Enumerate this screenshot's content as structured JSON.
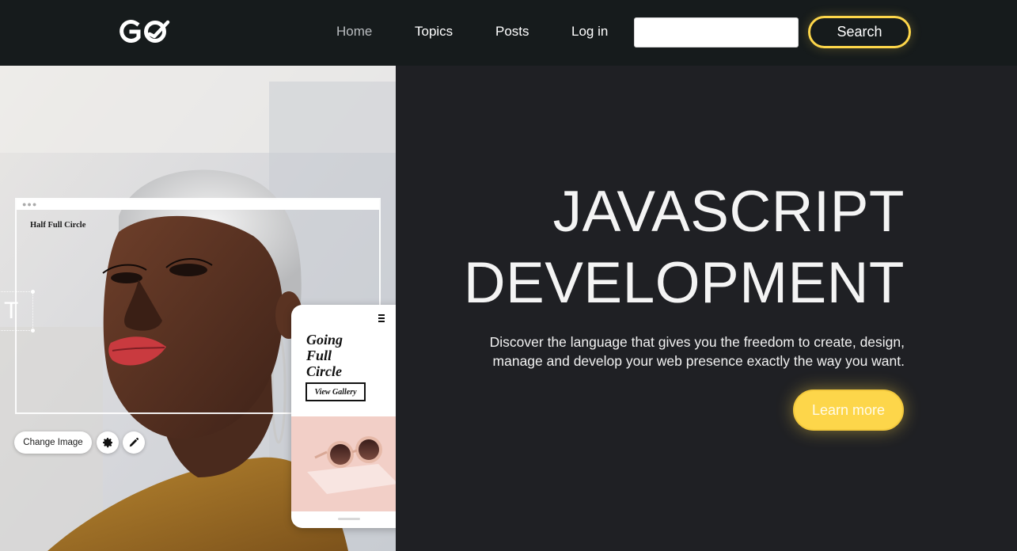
{
  "header": {
    "logo_alt": "GO logo",
    "nav": {
      "home": "Home",
      "topics": "Topics",
      "posts": "Posts",
      "login": "Log in"
    },
    "search_placeholder": "",
    "search_button": "Search"
  },
  "hero": {
    "title_line1": "JAVASCRIPT",
    "title_line2": "DEVELOPMENT",
    "subtitle_line1": "Discover the language that gives you the freedom to create, design,",
    "subtitle_line2": "manage and develop your web presence exactly the way you want.",
    "cta": "Learn more"
  },
  "editor_mock": {
    "frame_title": "Half Full Circle",
    "text_tool_glyph": "T",
    "change_image": "Change Image",
    "phone_title": "Going Full Circle",
    "phone_button": "View Gallery"
  },
  "colors": {
    "header_bg": "#161b1c",
    "hero_bg": "#1f2024",
    "accent": "#fdd64a",
    "text": "#ffffff"
  }
}
